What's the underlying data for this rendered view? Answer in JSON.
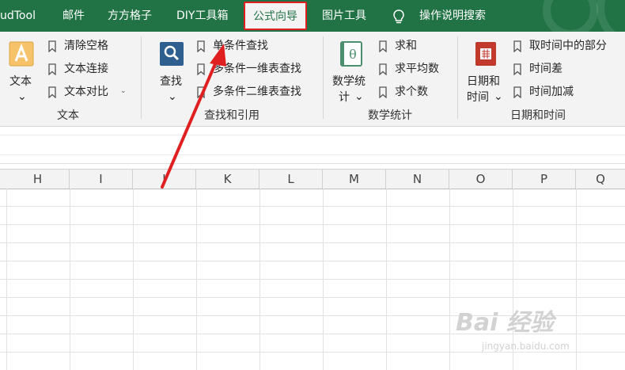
{
  "tabs": [
    {
      "label": "udTool"
    },
    {
      "label": "邮件"
    },
    {
      "label": "方方格子"
    },
    {
      "label": "DIY工具箱"
    },
    {
      "label": "公式向导",
      "active": true
    },
    {
      "label": "图片工具"
    }
  ],
  "tell_me": "操作说明搜索",
  "ribbon": {
    "text_group": {
      "label": "文本",
      "big_button": "文本",
      "items": [
        "清除空格",
        "文本连接",
        "文本对比"
      ]
    },
    "lookup_group": {
      "label": "查找和引用",
      "big_button": "查找",
      "items": [
        "单条件查找",
        "多条件一维表查找",
        "多条件二维表查找"
      ]
    },
    "math_group": {
      "label": "数学统计",
      "big_button_line1": "数学统",
      "big_button_line2": "计",
      "icon_glyph": "θ",
      "items": [
        "求和",
        "求平均数",
        "求个数"
      ]
    },
    "date_group": {
      "label": "日期和时间",
      "big_button_line1": "日期和",
      "big_button_line2": "时间",
      "items": [
        "取时间中的部分",
        "时间差",
        "时间加减"
      ]
    }
  },
  "columns": [
    "H",
    "I",
    "J",
    "K",
    "L",
    "M",
    "N",
    "O",
    "P",
    "Q"
  ],
  "watermark": {
    "brand": "Bai 经验",
    "url": "jingyan.baidu.com"
  },
  "colors": {
    "accent": "#217346",
    "highlight": "#e02020",
    "ribbon_bg": "#f3f3f3"
  }
}
